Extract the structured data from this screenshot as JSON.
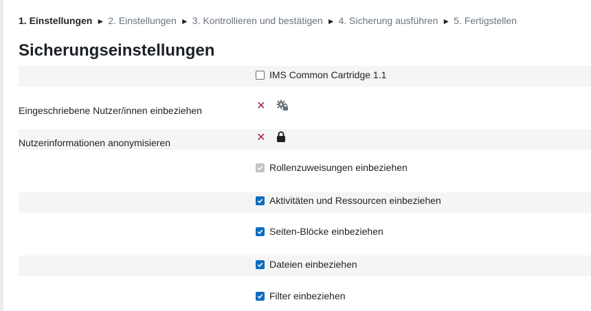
{
  "breadcrumb": {
    "steps": [
      {
        "label": "1. Einstellungen",
        "current": true
      },
      {
        "label": "2. Einstellungen",
        "current": false
      },
      {
        "label": "3. Kontrollieren und bestätigen",
        "current": false
      },
      {
        "label": "4. Sicherung ausführen",
        "current": false
      },
      {
        "label": "5. Fertigstellen",
        "current": false
      }
    ],
    "separator": "►"
  },
  "page_title": "Sicherungseinstellungen",
  "settings": {
    "imscc": {
      "label": "IMS Common Cartridge 1.1",
      "checked": false
    },
    "users": {
      "label": "Eingeschriebene Nutzer/innen einbeziehen",
      "status_icon": "x-icon",
      "lock_icon": "cog-lock-icon"
    },
    "anonymize": {
      "label": "Nutzerinformationen anonymisieren",
      "status_icon": "x-icon",
      "lock_icon": "lock-icon"
    },
    "roles": {
      "label": "Rollenzuweisungen einbeziehen",
      "checked": true,
      "disabled": true
    },
    "activities": {
      "label": "Aktivitäten und Ressourcen einbeziehen",
      "checked": true
    },
    "blocks": {
      "label": "Seiten-Blöcke einbeziehen",
      "checked": true
    },
    "files": {
      "label": "Dateien einbeziehen",
      "checked": true
    },
    "filters": {
      "label": "Filter einbeziehen",
      "checked": true
    }
  },
  "status_glyph": "✕",
  "colors": {
    "accent": "#0f6cbf",
    "cross": "#a4204f",
    "row_shade": "#f5f5f5"
  }
}
